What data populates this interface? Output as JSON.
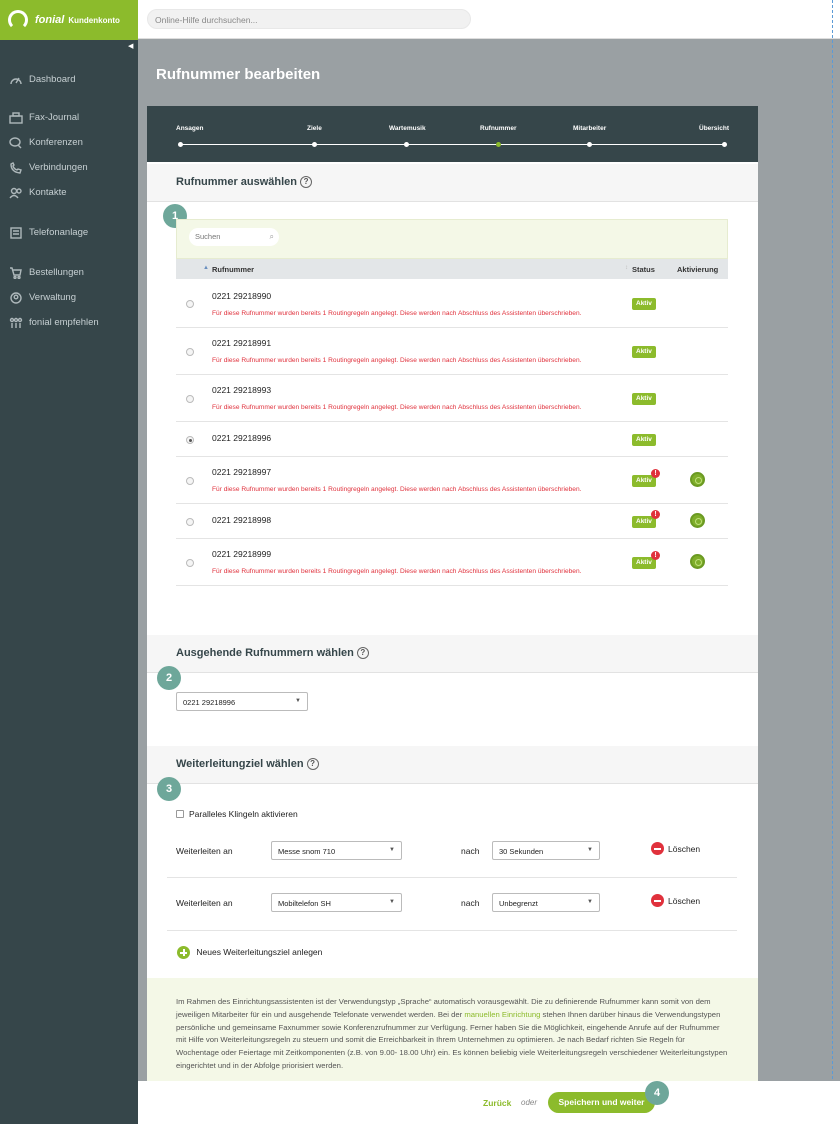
{
  "sidebar": {
    "brand": "fonial",
    "brand_sub": "Kundenkonto",
    "items": [
      {
        "label": "Dashboard",
        "icon": "gauge-icon"
      },
      {
        "label": "Fax-Journal",
        "icon": "fax-icon"
      },
      {
        "label": "Konferenzen",
        "icon": "chat-icon"
      },
      {
        "label": "Verbindungen",
        "icon": "phone-icon"
      },
      {
        "label": "Kontakte",
        "icon": "contacts-icon"
      },
      {
        "label": "Telefonanlage",
        "icon": "pbx-icon"
      },
      {
        "label": "Bestellungen",
        "icon": "cart-icon"
      },
      {
        "label": "Verwaltung",
        "icon": "user-circle-icon"
      },
      {
        "label": "fonial empfehlen",
        "icon": "recommend-icon"
      }
    ]
  },
  "topbar": {
    "search_placeholder": "Online-Hilfe durchsuchen..."
  },
  "page": {
    "title": "Rufnummer bearbeiten"
  },
  "wizard": {
    "steps": [
      "Ansagen",
      "Ziele",
      "Wartemusik",
      "Rufnummer",
      "Mitarbeiter",
      "Übersicht"
    ],
    "active_step": "Rufnummer"
  },
  "section1": {
    "number": "1",
    "title": "Rufnummer auswählen",
    "search_placeholder": "Suchen",
    "col_number": "Rufnummer",
    "col_status": "Status",
    "col_activation": "Aktivierung",
    "rows": [
      {
        "number": "0221 29218990",
        "warning": "Für diese Rufnummer wurden bereits 1 Routingregeln angelegt. Diese werden nach Abschluss des Assistenten überschrieben.",
        "status": "Aktiv",
        "checked": false
      },
      {
        "number": "0221 29218991",
        "warning": "Für diese Rufnummer wurden bereits 1 Routingregeln angelegt. Diese werden nach Abschluss des Assistenten überschrieben.",
        "status": "Aktiv",
        "checked": false
      },
      {
        "number": "0221 29218993",
        "warning": "Für diese Rufnummer wurden bereits 1 Routingregeln angelegt. Diese werden nach Abschluss des Assistenten überschrieben.",
        "status": "Aktiv",
        "checked": false
      },
      {
        "number": "0221 29218996",
        "warning": "",
        "status": "Aktiv",
        "checked": true
      },
      {
        "number": "0221 29218997",
        "warning": "Für diese Rufnummer wurden bereits 1 Routingregeln angelegt. Diese werden nach Abschluss des Assistenten überschrieben.",
        "status": "Aktiv",
        "checked": false,
        "alert": "!"
      },
      {
        "number": "0221 29218998",
        "warning": "",
        "status": "Aktiv",
        "checked": false,
        "alert": "!"
      },
      {
        "number": "0221 29218999",
        "warning": "Für diese Rufnummer wurden bereits 1 Routingregeln angelegt. Diese werden nach Abschluss des Assistenten überschrieben.",
        "status": "Aktiv",
        "checked": false,
        "alert": "!"
      }
    ]
  },
  "section2": {
    "number": "2",
    "title": "Ausgehende Rufnummern wählen",
    "selected": "0221 29218996"
  },
  "section3": {
    "number": "3",
    "title": "Weiterleitungziel wählen",
    "parallel_label": "Paralleles Klingeln aktivieren",
    "forwards": [
      {
        "label": "Weiterleiten an",
        "target": "Messe snom 710",
        "after": "nach",
        "time": "30 Sekunden",
        "delete": "Löschen"
      },
      {
        "label": "Weiterleiten an",
        "target": "Mobiltelefon SH",
        "after": "nach",
        "time": "Unbegrenzt",
        "delete": "Löschen"
      }
    ],
    "add_label": "Neues Weiterleitungsziel anlegen"
  },
  "info": {
    "text_before": "Im Rahmen des Einrichtungsassistenten ist der Verwendungstyp „Sprache“ automatisch vorausgewählt. Die zu definierende Rufnummer kann somit von dem jeweiligen Mitarbeiter für ein und ausgehende Telefonate verwendet werden. Bei der ",
    "link": "manuellen Einrichtung",
    "text_after": " stehen Ihnen darüber hinaus die Verwendungstypen persönliche und gemeinsame Faxnummer sowie Konferenzrufnummer zur Verfügung. Ferner haben Sie die Möglichkeit, eingehende Anrufe auf der Rufnummer mit Hilfe von Weiterleitungsregeln zu steuern und somit die Erreichbarkeit in Ihrem Unternehmen zu optimieren. Je nach Bedarf richten Sie Regeln für Wochentage oder Feiertage mit Zeitkomponenten (z.B. von 9.00- 18.00 Uhr) ein. Es können beliebig viele Weiterleitungsregeln verschiedener Weiterleitungstypen eingerichtet und in der Abfolge priorisiert werden."
  },
  "footer": {
    "back": "Zurück",
    "or": "oder",
    "save": "Speichern und weiter",
    "number": "4"
  },
  "colors": {
    "accent": "#8cbb2c",
    "sidebar": "#36464a",
    "warning": "#e0313c",
    "badge": "#6ea79a"
  }
}
